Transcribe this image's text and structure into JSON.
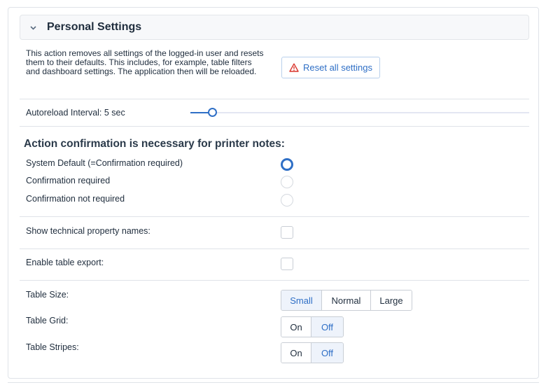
{
  "header": {
    "title": "Personal Settings"
  },
  "reset": {
    "description": "This action removes all settings of the logged-in user and resets them to their defaults. This includes, for example, table filters and dashboard settings. The application then will be reloaded.",
    "button_label": "Reset all settings"
  },
  "autoreload": {
    "label": "Autoreload Interval: 5 sec",
    "value_seconds": 5
  },
  "confirmation": {
    "title": "Action confirmation is necessary for printer notes:",
    "options": [
      {
        "label": "System Default (=Confirmation required)",
        "selected": true
      },
      {
        "label": "Confirmation required",
        "selected": false
      },
      {
        "label": "Confirmation not required",
        "selected": false
      }
    ]
  },
  "technical_names": {
    "label": "Show technical property names:",
    "checked": false
  },
  "table_export": {
    "label": "Enable table export:",
    "checked": false
  },
  "table_size": {
    "label": "Table Size:",
    "options": [
      "Small",
      "Normal",
      "Large"
    ],
    "selected": "Small"
  },
  "table_grid": {
    "label": "Table Grid:",
    "options": [
      "On",
      "Off"
    ],
    "selected": "Off"
  },
  "table_stripes": {
    "label": "Table Stripes:",
    "options": [
      "On",
      "Off"
    ],
    "selected": "Off"
  },
  "colors": {
    "accent": "#2f6fc6",
    "warning": "#d9342b"
  }
}
